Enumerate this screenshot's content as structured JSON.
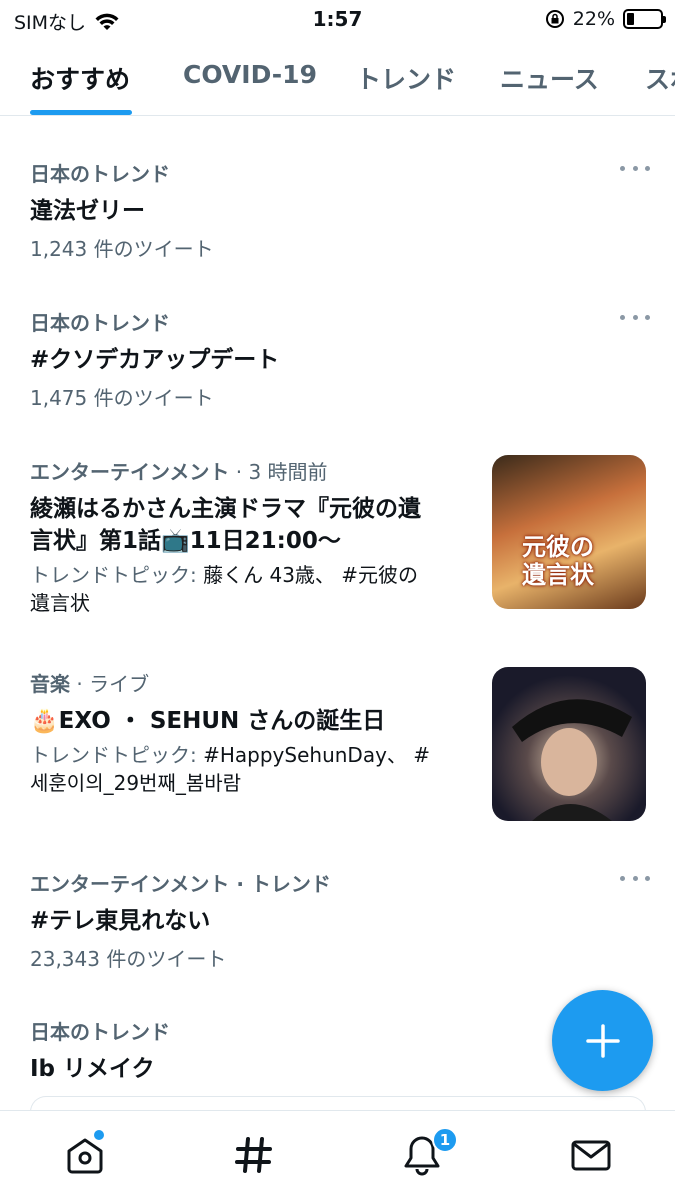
{
  "status_bar": {
    "carrier": "SIMなし",
    "time": "1:57",
    "battery": "22%",
    "icons": [
      "wifi-icon",
      "rotation-lock-icon",
      "battery-icon"
    ]
  },
  "tabs": [
    {
      "label": "おすすめ",
      "active": true
    },
    {
      "label": "COVID-19",
      "active": false
    },
    {
      "label": "トレンド",
      "active": false
    },
    {
      "label": "ニュース",
      "active": false
    },
    {
      "label": "スポ",
      "active": false
    }
  ],
  "trends": [
    {
      "category": "日本のトレンド",
      "title": "違法ゼリー",
      "count": "1,243 件のツイート"
    },
    {
      "category": "日本のトレンド",
      "title": "#クソデカアップデート",
      "count": "1,475 件のツイート"
    },
    {
      "category": "エンターテインメント",
      "meta": " · 3 時間前",
      "title_line1": "綾瀬はるかさん主演ドラマ『元彼の遺",
      "title_line2": "言状』第1話📺11日21:00～",
      "topic_prefix": "トレンドトピック: ",
      "topic_line1": "藤くん 43歳、 #元彼の",
      "topic_line2": "遺言状",
      "image_text": "元彼の\n遺言状"
    },
    {
      "category": "音楽",
      "meta": " · ライブ",
      "title": "🎂EXO ・ SEHUN さんの誕生日",
      "topic_prefix": "トレンドトピック: ",
      "topic_line1": "#HappySehunDay、 #",
      "topic_line2": "세훈이의_29번째_봄바람"
    },
    {
      "category": "エンターテインメント · トレンド",
      "title": "#テレ東見れない",
      "count": "23,343 件のツイート"
    },
    {
      "category": "日本のトレンド",
      "title": "Ib リメイク"
    }
  ],
  "bottom_nav": {
    "items": [
      "home-icon",
      "explore-hashtag-icon",
      "notifications-bell-icon",
      "messages-envelope-icon"
    ],
    "notification_count": "1"
  },
  "colors": {
    "accent": "#1d9bf0",
    "secondary_text": "#536471",
    "primary_text": "#0f1419"
  }
}
